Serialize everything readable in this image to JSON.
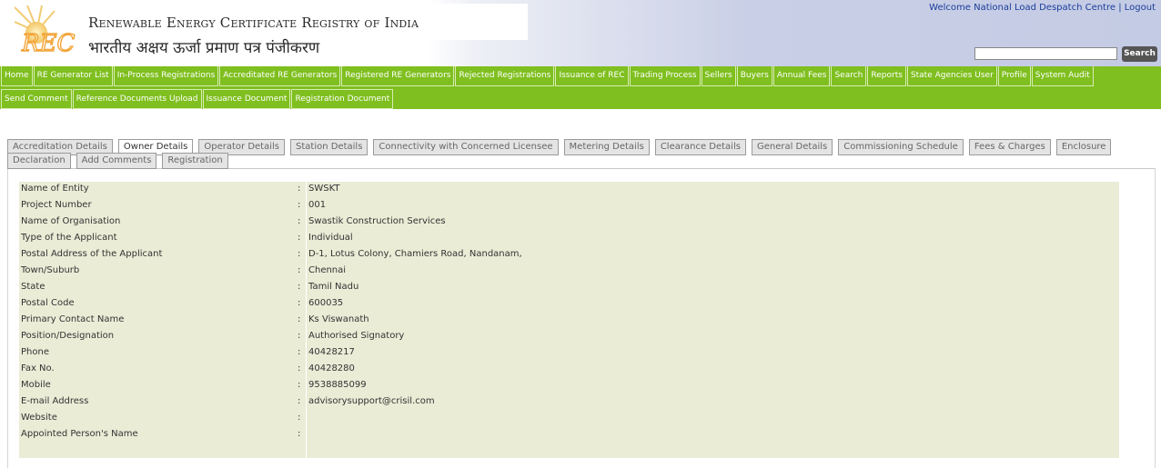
{
  "header": {
    "brand_en": "Renewable Energy Certificate Registry of India",
    "brand_hi": "भारतीय अक्षय ऊर्जा प्रमाण पत्र पंजीकरण",
    "logo_text": "REC",
    "welcome": "Welcome National Load Despatch Centre | Logout",
    "search_button": "Search",
    "search_value": ""
  },
  "nav": {
    "row1": [
      "Home",
      "RE Generator List",
      "In-Process Registrations",
      "Accreditated RE Generators",
      "Registered RE Generators",
      "Rejected Registrations",
      "Issuance of REC",
      "Trading Process",
      "Sellers",
      "Buyers",
      "Annual Fees",
      "Search",
      "Reports",
      "State Agencies User",
      "Profile",
      "System Audit"
    ],
    "row2": [
      "Send Comment",
      "Reference Documents Upload",
      "Issuance Document",
      "Registration Document"
    ]
  },
  "tabs": {
    "row1": [
      "Accreditation Details",
      "Owner Details",
      "Operator Details",
      "Station Details",
      "Connectivity with Concerned Licensee",
      "Metering Details",
      "Clearance Details",
      "General Details",
      "Commissioning Schedule",
      "Fees & Charges",
      "Enclosure"
    ],
    "row2": [
      "Declaration",
      "Add Comments",
      "Registration"
    ],
    "active": "Owner Details"
  },
  "details": [
    {
      "label": "Name of Entity",
      "value": "SWSKT"
    },
    {
      "label": "Project Number",
      "value": "001"
    },
    {
      "label": "Name of Organisation",
      "value": "Swastik Construction Services"
    },
    {
      "label": "Type of the Applicant",
      "value": "Individual"
    },
    {
      "label": "Postal Address of the Applicant",
      "value": "D-1, Lotus Colony, Chamiers Road, Nandanam,"
    },
    {
      "label": "Town/Suburb",
      "value": "Chennai"
    },
    {
      "label": "State",
      "value": "Tamil Nadu"
    },
    {
      "label": "Postal Code",
      "value": "600035"
    },
    {
      "label": "Primary Contact Name",
      "value": "Ks Viswanath"
    },
    {
      "label": "Position/Designation",
      "value": "Authorised Signatory"
    },
    {
      "label": "Phone",
      "value": "40428217"
    },
    {
      "label": "Fax No.",
      "value": "40428280"
    },
    {
      "label": "Mobile",
      "value": "9538885099"
    },
    {
      "label": "E-mail Address",
      "value": "advisorysupport@crisil.com"
    },
    {
      "label": "Website",
      "value": ""
    },
    {
      "label": "Appointed Person's Name",
      "value": ""
    }
  ],
  "colors": {
    "nav_green": "#7fbf1f",
    "panel_bg": "#eaecd6",
    "link_blue": "#1a3d9a",
    "logo_orange": "#f3a53a"
  }
}
